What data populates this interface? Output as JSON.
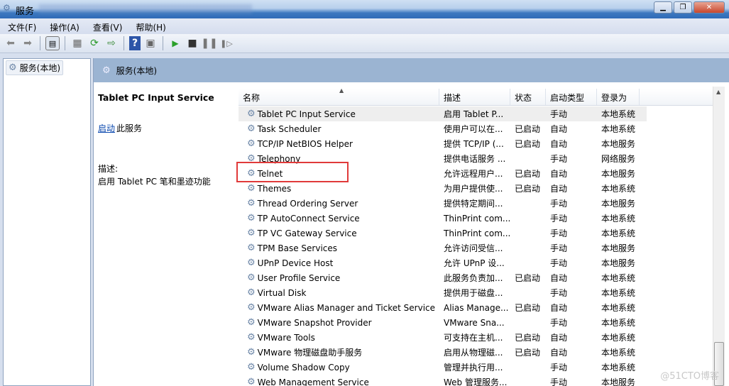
{
  "window": {
    "title": "服务",
    "minimize": "▁",
    "restore": "❐",
    "close": "✕"
  },
  "menu": [
    "文件(F)",
    "操作(A)",
    "查看(V)",
    "帮助(H)"
  ],
  "tree": {
    "root": "服务(本地)"
  },
  "panel": {
    "title": "服务(本地)"
  },
  "details": {
    "service_name": "Tablet PC Input Service",
    "start_link": "启动",
    "start_rest": "此服务",
    "desc_label": "描述:",
    "desc_text": "启用 Tablet PC 笔和墨迹功能"
  },
  "columns": [
    "名称",
    "描述",
    "状态",
    "启动类型",
    "登录为"
  ],
  "rows": [
    [
      "Tablet PC Input Service",
      "启用 Tablet P...",
      "",
      "手动",
      "本地系统"
    ],
    [
      "Task Scheduler",
      "使用户可以在...",
      "已启动",
      "自动",
      "本地系统"
    ],
    [
      "TCP/IP NetBIOS Helper",
      "提供 TCP/IP (...",
      "已启动",
      "自动",
      "本地服务"
    ],
    [
      "Telephony",
      "提供电话服务 ...",
      "",
      "手动",
      "网络服务"
    ],
    [
      "Telnet",
      "允许远程用户...",
      "已启动",
      "自动",
      "本地服务"
    ],
    [
      "Themes",
      "为用户提供使...",
      "已启动",
      "自动",
      "本地系统"
    ],
    [
      "Thread Ordering Server",
      "提供特定期间...",
      "",
      "手动",
      "本地服务"
    ],
    [
      "TP AutoConnect Service",
      "ThinPrint com...",
      "",
      "手动",
      "本地系统"
    ],
    [
      "TP VC Gateway Service",
      "ThinPrint com...",
      "",
      "手动",
      "本地系统"
    ],
    [
      "TPM Base Services",
      "允许访问受信...",
      "",
      "手动",
      "本地服务"
    ],
    [
      "UPnP Device Host",
      "允许 UPnP 设...",
      "",
      "手动",
      "本地服务"
    ],
    [
      "User Profile Service",
      "此服务负责加...",
      "已启动",
      "自动",
      "本地系统"
    ],
    [
      "Virtual Disk",
      "提供用于磁盘...",
      "",
      "手动",
      "本地系统"
    ],
    [
      "VMware Alias Manager and Ticket Service",
      "Alias Manage...",
      "已启动",
      "自动",
      "本地系统"
    ],
    [
      "VMware Snapshot Provider",
      "VMware Sna...",
      "",
      "手动",
      "本地系统"
    ],
    [
      "VMware Tools",
      "可支持在主机...",
      "已启动",
      "自动",
      "本地系统"
    ],
    [
      "VMware 物理磁盘助手服务",
      "启用从物理磁...",
      "已启动",
      "自动",
      "本地系统"
    ],
    [
      "Volume Shadow Copy",
      "管理并执行用...",
      "",
      "手动",
      "本地系统"
    ],
    [
      "Web Management Service",
      "Web 管理服务...",
      "",
      "手动",
      "本地服务"
    ]
  ],
  "watermark": "@51CTO博客"
}
